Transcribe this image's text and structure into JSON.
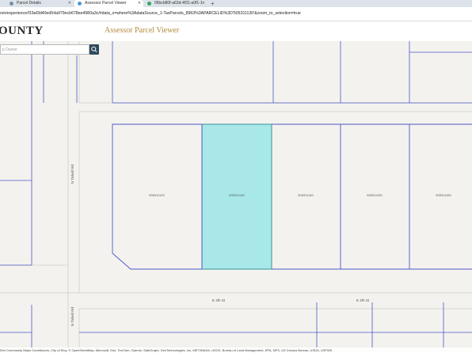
{
  "browser": {
    "tabs": [
      {
        "label": "Parcel Details",
        "active": false,
        "icon": "globe-icon"
      },
      {
        "label": "Assessor Parcel Viewer",
        "active": true,
        "icon": "app-icon"
      },
      {
        "label": "06bcb80f-a63d-4f31-a0f1-1",
        "active": false,
        "icon": "map-icon"
      }
    ],
    "new_tab": "+",
    "url": "om/experience/f19af3d40ed54a979ecb678ee4980a3c/#data_s=where%3AdataSource_1-TaxParcels_8963%3APARCELID%3D'505311130'&zoom_to_selection=true"
  },
  "header": {
    "county": "OUNTY",
    "title": "Assessor Parcel Viewer"
  },
  "search": {
    "placeholder": "p Owner"
  },
  "map": {
    "colors": {
      "background": "#f4f2ee",
      "parcel_line": "#4b56c8",
      "road_line": "#d3d0cb",
      "selected_fill": "#a8e8e8",
      "selected_stroke": "#2f8f8f"
    },
    "parcels": [
      {
        "id": "505311120",
        "selected": false
      },
      {
        "id": "505311130",
        "selected": true
      },
      {
        "id": "505311140",
        "selected": false
      },
      {
        "id": "505311150",
        "selected": false
      },
      {
        "id": "505311160",
        "selected": false
      }
    ],
    "streets": [
      {
        "name": "N Tickell Rd"
      },
      {
        "name": "N Tickell Rd"
      },
      {
        "name": "E 4th St"
      },
      {
        "name": "E 4th St"
      },
      {
        "name": "N"
      }
    ]
  },
  "attribution": "Esri Community Maps Contributors, City of Eloy, © OpenStreetMap, Microsoft, Esri, TomTom, Garmin, SafeGraph, GeoTechnologies, Inc, METI/NASA, USGS, Bureau of Land Management, EPA, NPS, US Census Bureau, USDA, USFWS"
}
